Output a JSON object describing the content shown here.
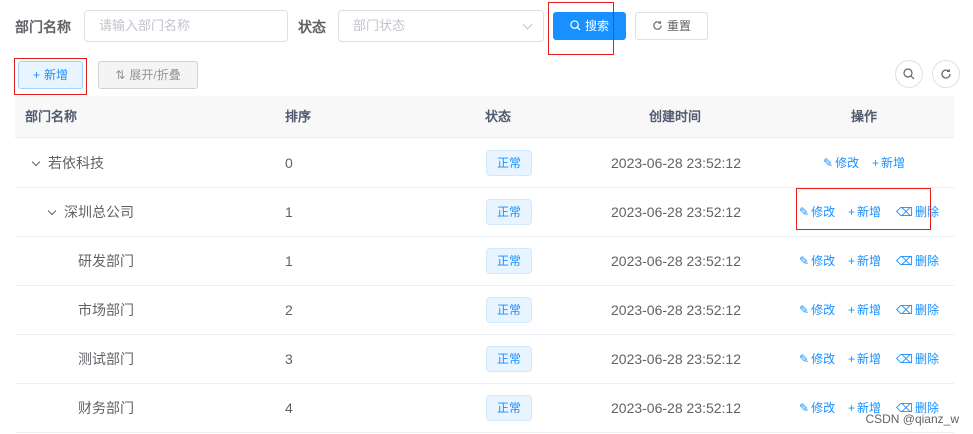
{
  "search_form": {
    "dept_name_label": "部门名称",
    "dept_name_placeholder": "请输入部门名称",
    "status_label": "状态",
    "status_placeholder": "部门状态",
    "search_button": "搜索",
    "reset_button": "重置"
  },
  "toolbar": {
    "add_button": "新增",
    "toggle_button": "展开/折叠"
  },
  "table": {
    "columns": [
      "部门名称",
      "排序",
      "状态",
      "创建时间",
      "操作"
    ],
    "actions": {
      "edit": "修改",
      "add": "新增",
      "delete": "删除"
    },
    "rows": [
      {
        "name": "若依科技",
        "order": "0",
        "status": "正常",
        "created": "2023-06-28 23:52:12"
      },
      {
        "name": "深圳总公司",
        "order": "1",
        "status": "正常",
        "created": "2023-06-28 23:52:12"
      },
      {
        "name": "研发部门",
        "order": "1",
        "status": "正常",
        "created": "2023-06-28 23:52:12"
      },
      {
        "name": "市场部门",
        "order": "2",
        "status": "正常",
        "created": "2023-06-28 23:52:12"
      },
      {
        "name": "测试部门",
        "order": "3",
        "status": "正常",
        "created": "2023-06-28 23:52:12"
      },
      {
        "name": "财务部门",
        "order": "4",
        "status": "正常",
        "created": "2023-06-28 23:52:12"
      }
    ]
  },
  "watermark": "CSDN @qianz_w",
  "colors": {
    "primary": "#1890ff",
    "highlight_box": "#e02020"
  }
}
